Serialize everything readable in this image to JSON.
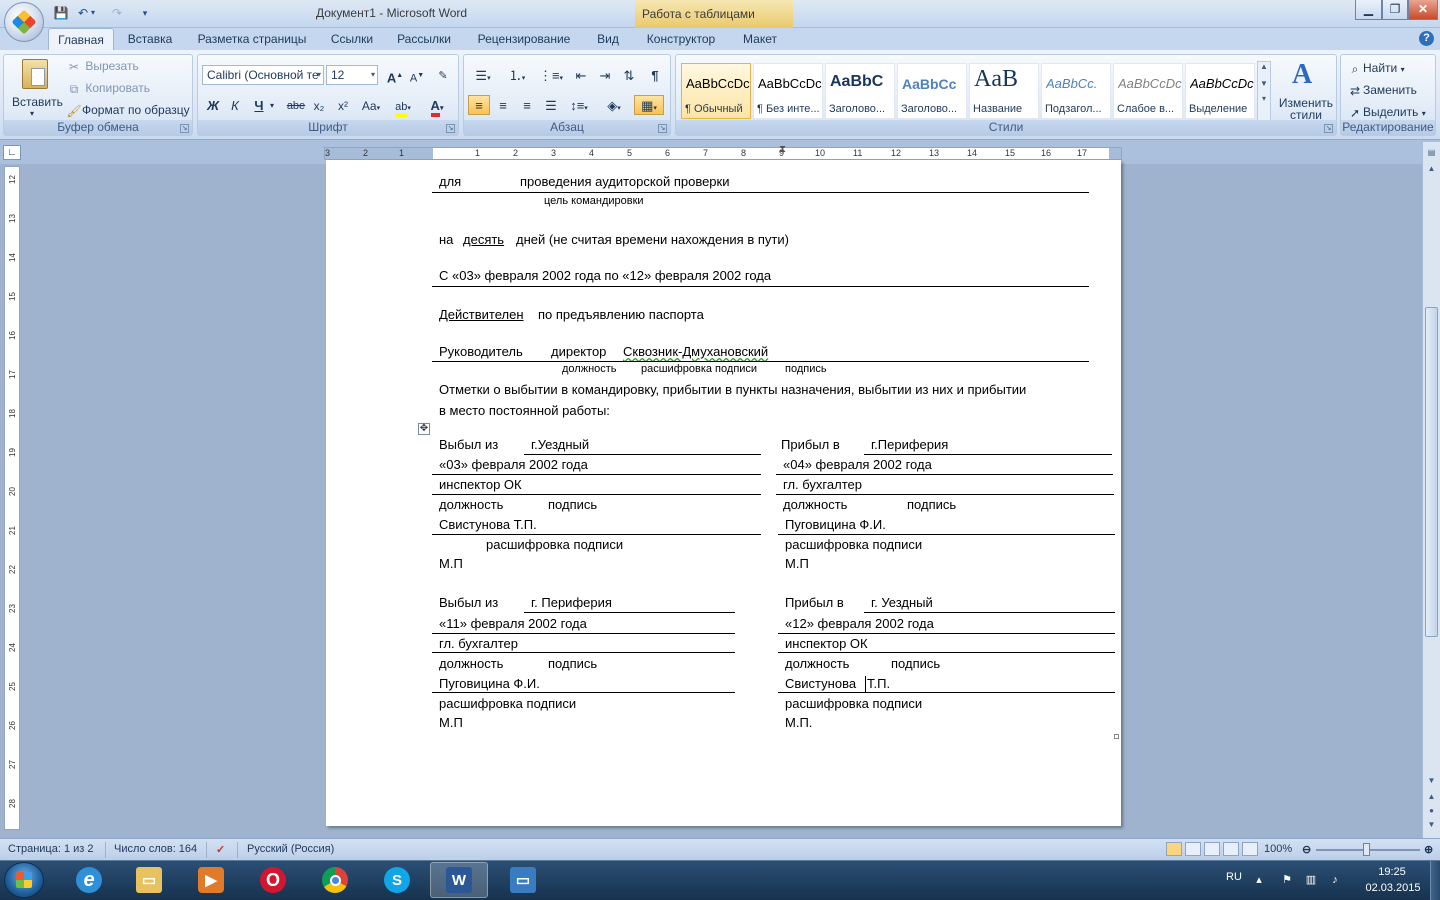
{
  "window": {
    "title": "Документ1 - Microsoft Word",
    "context_tab_title": "Работа с таблицами"
  },
  "tabs": [
    "Главная",
    "Вставка",
    "Разметка страницы",
    "Ссылки",
    "Рассылки",
    "Рецензирование",
    "Вид",
    "Конструктор",
    "Макет"
  ],
  "ribbon": {
    "clipboard": {
      "label": "Буфер обмена",
      "paste": "Вставить",
      "cut": "Вырезать",
      "copy": "Копировать",
      "format_painter": "Формат по образцу"
    },
    "font": {
      "label": "Шрифт",
      "font_name": "Calibri (Основной те",
      "font_size": "12",
      "bold": "Ж",
      "italic": "К",
      "underline": "Ч",
      "strike": "abe",
      "subscript": "x₂",
      "superscript": "x²",
      "change_case": "Aa",
      "grow": "A",
      "shrink": "A",
      "font_color": "A"
    },
    "paragraph": {
      "label": "Абзац"
    },
    "styles": {
      "label": "Стили",
      "tiles": [
        {
          "sample": "AaBbCcDc",
          "name": "¶ Обычный"
        },
        {
          "sample": "AaBbCcDc",
          "name": "¶ Без инте..."
        },
        {
          "sample": "AaBbC",
          "name": "Заголово..."
        },
        {
          "sample": "AaBbCc",
          "name": "Заголово..."
        },
        {
          "sample": "AaB",
          "name": "Название"
        },
        {
          "sample": "AaBbCc.",
          "name": "Подзагол..."
        },
        {
          "sample": "AaBbCcDc",
          "name": "Слабое в..."
        },
        {
          "sample": "AaBbCcDc",
          "name": "Выделение"
        }
      ],
      "change_styles": "Изменить стили"
    },
    "editing": {
      "label": "Редактирование",
      "find": "Найти",
      "replace": "Заменить",
      "select": "Выделить"
    }
  },
  "ruler": {
    "numbers_left": [
      "3",
      "2",
      "1"
    ],
    "numbers_right": [
      "1",
      "2",
      "3",
      "4",
      "5",
      "6",
      "7",
      "8",
      "9",
      "10",
      "11",
      "12",
      "13",
      "14",
      "15",
      "16",
      "17"
    ],
    "vertical_numbers": [
      "12",
      "13",
      "14",
      "15",
      "16",
      "17",
      "18",
      "19",
      "20",
      "21",
      "22",
      "23",
      "24",
      "25",
      "26",
      "27",
      "28"
    ]
  },
  "document": {
    "line1_a": "для",
    "line1_b": "проведения  аудиторской проверки",
    "line1_caption": "цель командировки",
    "line2_a": "на",
    "line2_b": "десять",
    "line2_c": "дней (не считая времени нахождения в пути)",
    "line3": "С «03» февраля 2002  года по «12» февраля 2002  года",
    "line4_a": "Действителен",
    "line4_b": "по предъявлению паспорта",
    "line5_a": "Руководитель",
    "line5_b": "директор",
    "line5_c": "Сквозник-Дмухановский",
    "line5_caption_a": "должность",
    "line5_caption_b": "расшифровка  подписи",
    "line5_caption_c": "подпись",
    "notes_1": "Отметки о выбытии в командировку, прибытии в пункты назначения, выбытии из них и прибытии",
    "notes_2": "в место постоянной работы:",
    "table": {
      "c1": {
        "r1_a": "Выбыл из",
        "r1_b": "г.Уездный",
        "r2": "«03» февраля 2002 года",
        "r3": "инспектор ОК",
        "r4_a": "должность",
        "r4_b": "подпись",
        "r5": "Свистунова  Т.П.",
        "r6": "расшифровка подписи",
        "r7": "М.П"
      },
      "c2": {
        "r1_a": "Прибыл в",
        "r1_b": "г.Периферия",
        "r2": "«04» февраля 2002 года",
        "r3": "гл. бухгалтер",
        "r4_a": "должность",
        "r4_b": "подпись",
        "r5": "Пуговицина Ф.И.",
        "r6": "расшифровка подписи",
        "r7": "М.П"
      },
      "c3": {
        "r1_a": "Выбыл из",
        "r1_b": "г. Периферия",
        "r2": "«11» февраля 2002 года",
        "r3": "гл. бухгалтер",
        "r4_a": "должность",
        "r4_b": "подпись",
        "r5": "Пуговицина Ф.И.",
        "r6": "расшифровка подписи",
        "r7": "М.П"
      },
      "c4": {
        "r1_a": "Прибыл  в",
        "r1_b": "г. Уездный",
        "r2": "«12» февраля 2002 года",
        "r3": "инспектор ОК",
        "r4_a": "должность",
        "r4_b": "подпись",
        "r5_a": "Свистунова",
        "r5_b": "Т.П.",
        "r6": "расшифровка подписи",
        "r7": "М.П."
      }
    }
  },
  "statusbar": {
    "page": "Страница: 1 из 2",
    "words": "Число слов: 164",
    "language": "Русский (Россия)",
    "zoom": "100%"
  },
  "taskbar": {
    "lang": "RU",
    "time": "19:25",
    "date": "02.03.2015"
  },
  "colors": {
    "ribbon_bg": "#dae6f5",
    "accent_blue": "#1e395b",
    "context_tab": "#e9c96c"
  }
}
